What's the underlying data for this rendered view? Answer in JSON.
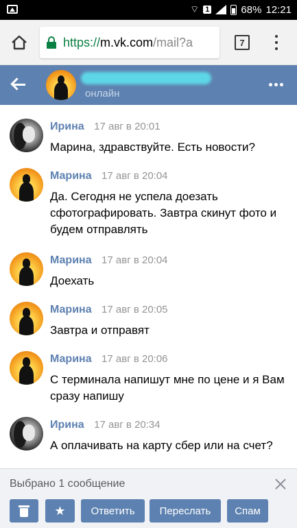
{
  "status_bar": {
    "sim_slot": "1",
    "battery": "68%",
    "time": "12:21"
  },
  "browser": {
    "url_scheme": "https://",
    "url_host": "m.vk.com",
    "url_path": "/mail?a",
    "tab_count": "7"
  },
  "chat_header": {
    "status": "онлайн"
  },
  "messages": [
    {
      "author": "Ирина",
      "time": "17 авг в 20:01",
      "text": "Марина, здравствуйте. Есть новости?"
    },
    {
      "author": "Марина",
      "time": "17 авг в 20:04",
      "text": "Да. Сегодня не успела доезать сфотографировать. Завтра скинут фото и будем отправлять"
    },
    {
      "author": "Марина",
      "time": "17 авг в 20:04",
      "text": "Доехать"
    },
    {
      "author": "Марина",
      "time": "17 авг в 20:05",
      "text": "Завтра и отправят"
    },
    {
      "author": "Марина",
      "time": "17 авг в 20:06",
      "text": "С терминала напишут мне по цене и я Вам сразу напишу"
    },
    {
      "author": "Ирина",
      "time": "17 авг в 20:34",
      "text": "А оплачивать на карту сбер или на счет?"
    }
  ],
  "action_bar": {
    "selected_label": "Выбрано 1 сообщение",
    "reply_label": "Ответить",
    "forward_label": "Переслать",
    "spam_label": "Спам"
  },
  "colors": {
    "vk_header": "#5d81b0",
    "author_name": "#5d81b0",
    "https_green": "#0b8043"
  }
}
